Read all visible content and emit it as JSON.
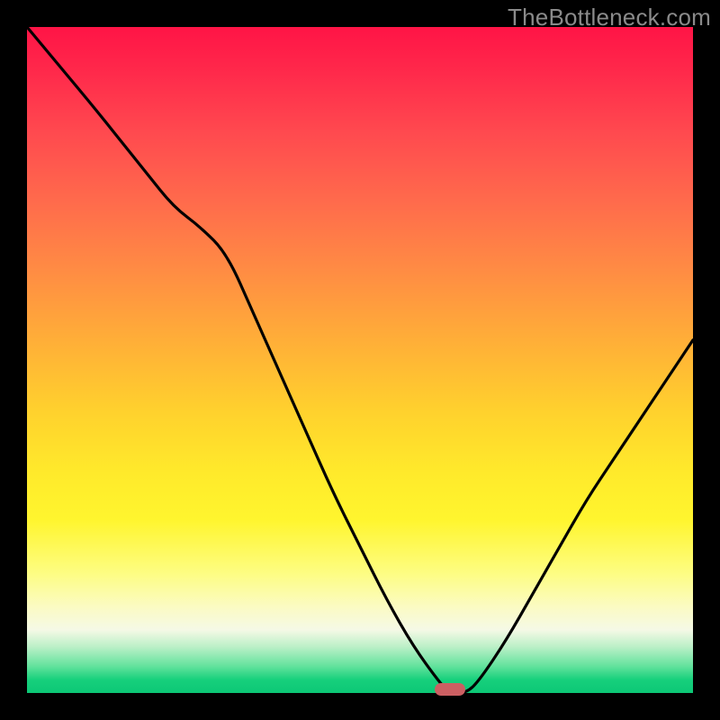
{
  "watermark": "TheBottleneck.com",
  "chart_data": {
    "type": "line",
    "title": "",
    "xlabel": "",
    "ylabel": "",
    "xlim": [
      0,
      100
    ],
    "ylim": [
      0,
      100
    ],
    "grid": false,
    "legend": false,
    "annotations": [],
    "series": [
      {
        "name": "bottleneck-curve",
        "x": [
          0,
          5,
          10,
          14,
          18,
          22,
          26,
          30,
          34,
          38,
          42,
          46,
          50,
          54,
          58,
          62,
          63.5,
          66,
          68,
          72,
          76,
          80,
          84,
          88,
          92,
          96,
          100
        ],
        "values": [
          100,
          94,
          88,
          83,
          78,
          73,
          70,
          66,
          57,
          48,
          39,
          30,
          22,
          14,
          7,
          1.5,
          0,
          0,
          2,
          8,
          15,
          22,
          29,
          35,
          41,
          47,
          53
        ]
      }
    ],
    "optimum_marker": {
      "x": 63.5,
      "width_pct": 4.5
    },
    "background_gradient": {
      "stops": [
        {
          "pct": 0,
          "color": "#ff1446"
        },
        {
          "pct": 50,
          "color": "#ffd22d"
        },
        {
          "pct": 75,
          "color": "#fff52e"
        },
        {
          "pct": 95,
          "color": "#62e29c"
        },
        {
          "pct": 100,
          "color": "#0cc776"
        }
      ]
    }
  }
}
